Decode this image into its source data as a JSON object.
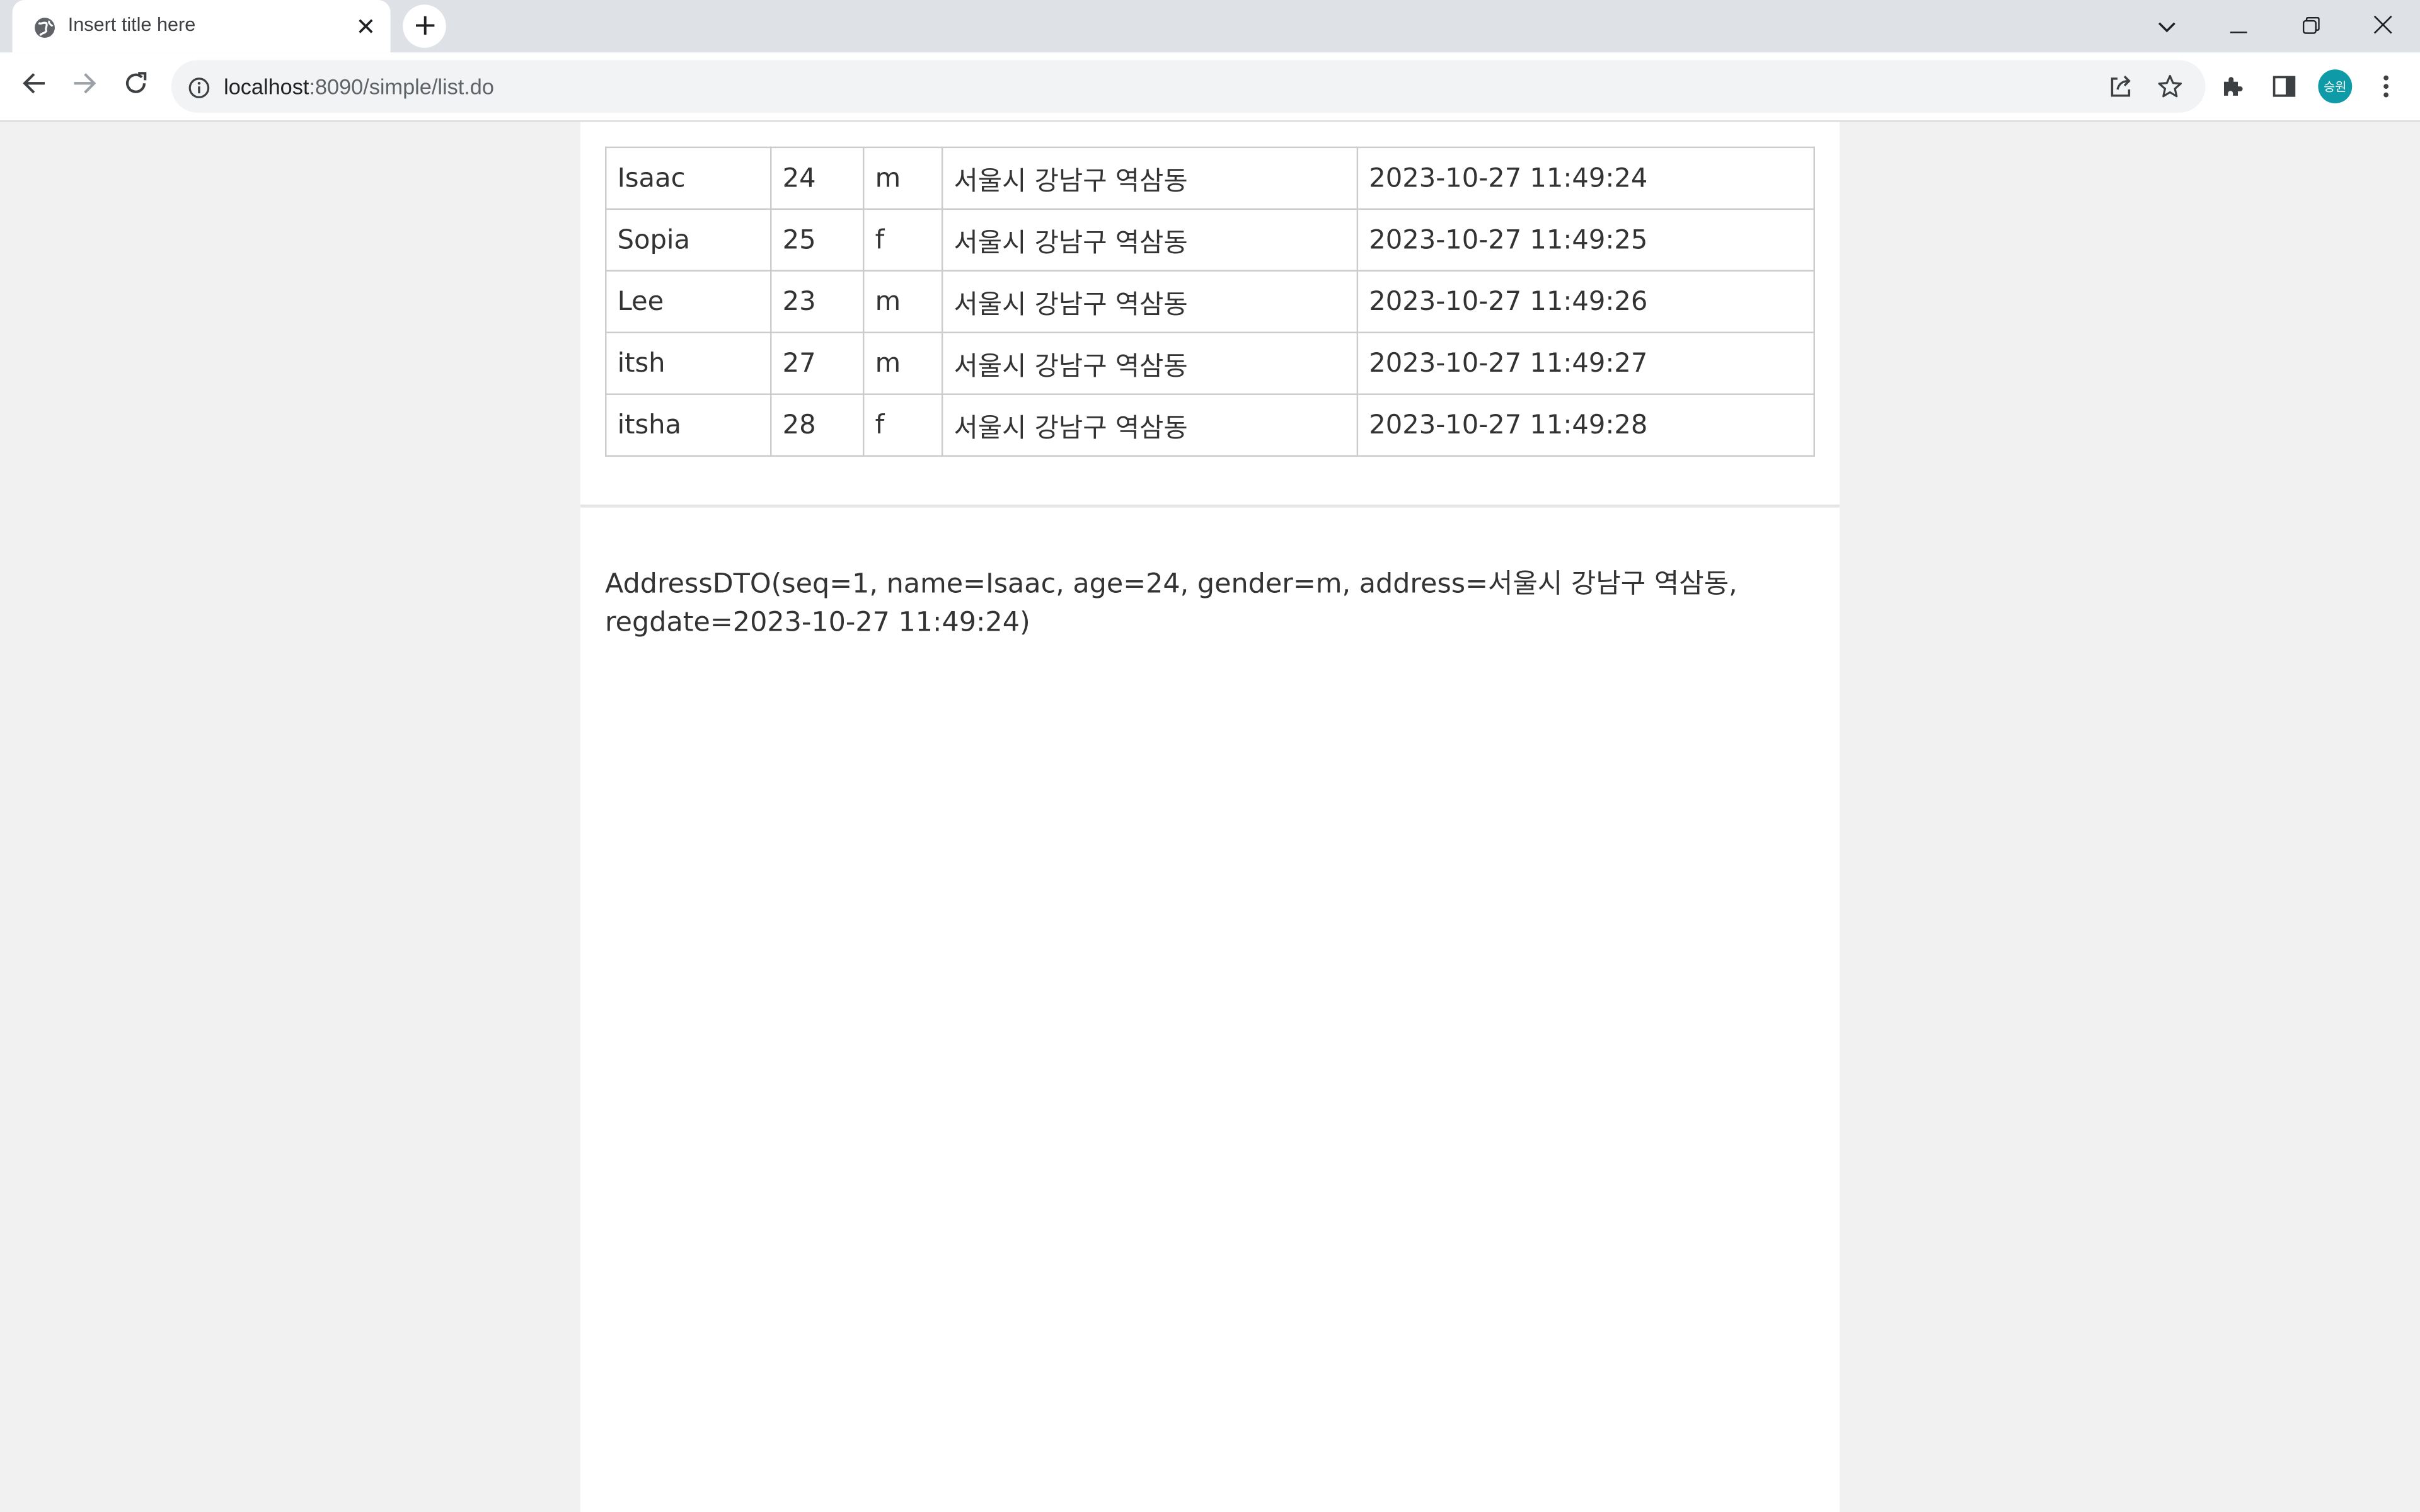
{
  "browser": {
    "tab_title": "Insert title here",
    "url_host": "localhost",
    "url_rest": ":8090/simple/list.do",
    "profile_initials": "승원",
    "profile_color": "#0e9aa7"
  },
  "table": {
    "rows": [
      {
        "name": "Isaac",
        "age": "24",
        "gender": "m",
        "address": "서울시 강남구 역삼동",
        "regdate": "2023-10-27 11:49:24"
      },
      {
        "name": "Sopia",
        "age": "25",
        "gender": "f",
        "address": "서울시 강남구 역삼동",
        "regdate": "2023-10-27 11:49:25"
      },
      {
        "name": "Lee",
        "age": "23",
        "gender": "m",
        "address": "서울시 강남구 역삼동",
        "regdate": "2023-10-27 11:49:26"
      },
      {
        "name": "itsh",
        "age": "27",
        "gender": "m",
        "address": "서울시 강남구 역삼동",
        "regdate": "2023-10-27 11:49:27"
      },
      {
        "name": "itsha",
        "age": "28",
        "gender": "f",
        "address": "서울시 강남구 역삼동",
        "regdate": "2023-10-27 11:49:28"
      }
    ]
  },
  "dto_text": "AddressDTO(seq=1, name=Isaac, age=24, gender=m, address=서울시 강남구 역삼동, regdate=2023-10-27 11:49:24)",
  "icons": {
    "tab_favicon": "globe-icon",
    "tab_close": "close-icon",
    "new_tab": "plus-icon",
    "back": "arrow-left-icon",
    "forward": "arrow-right-icon",
    "reload": "reload-icon",
    "site_info": "info-icon",
    "share": "share-icon",
    "bookmark": "star-icon",
    "extensions": "puzzle-icon",
    "side_panel": "side-panel-icon",
    "menu": "kebab-menu-icon",
    "tab_search": "chevron-down-icon",
    "minimize": "minimize-icon",
    "restore": "restore-icon",
    "close_window": "close-icon"
  }
}
